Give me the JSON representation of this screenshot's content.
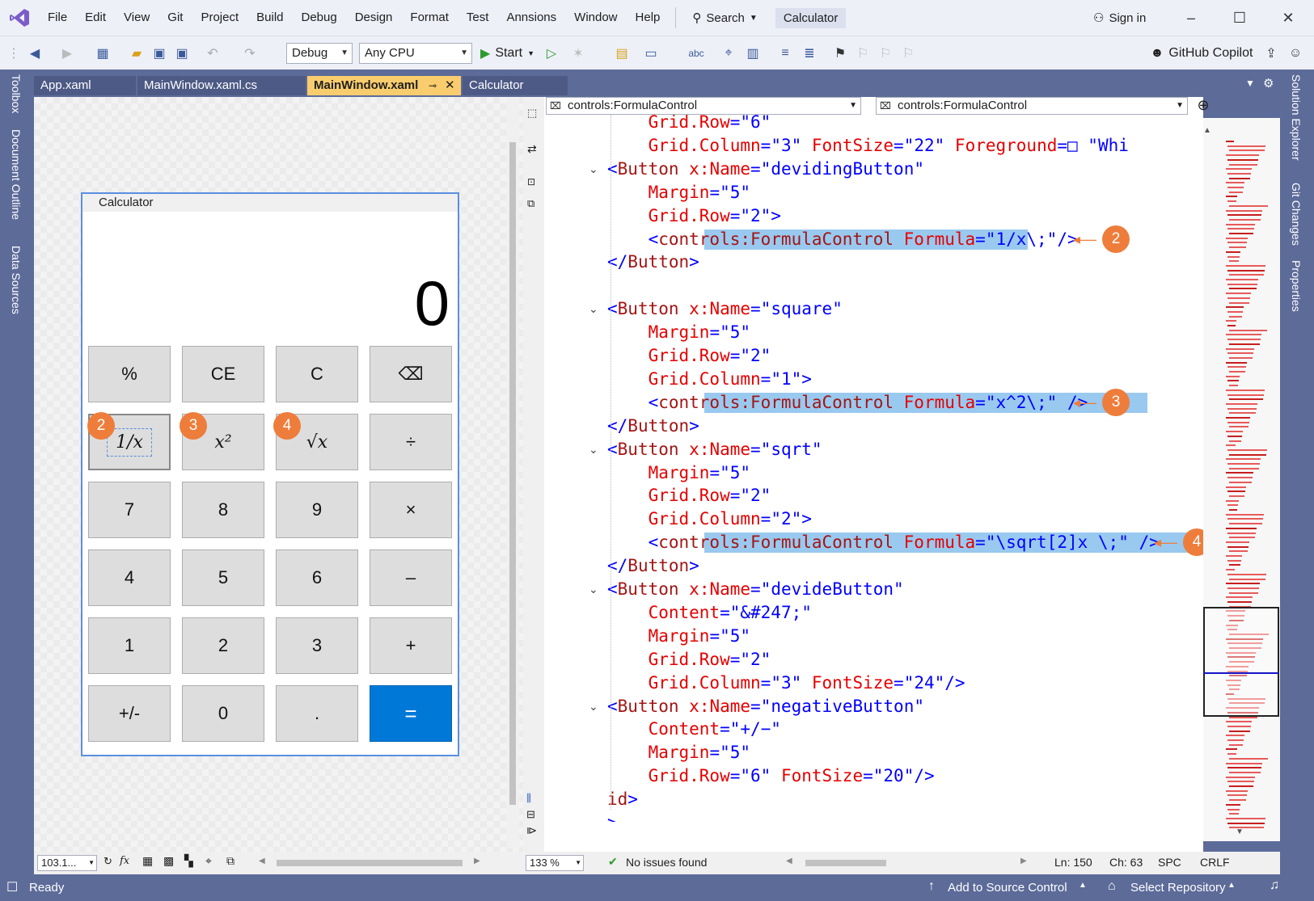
{
  "menu": {
    "items": [
      "File",
      "Edit",
      "View",
      "Git",
      "Project",
      "Build",
      "Debug",
      "Design",
      "Format",
      "Test",
      "Annsions",
      "Window",
      "Help"
    ],
    "search_label": "Search",
    "title_badge": "Calculator",
    "sign_in": "Sign in"
  },
  "toolbar": {
    "config": "Debug",
    "platform": "Any CPU",
    "start": "Start",
    "copilot": "GitHub Copilot"
  },
  "left_tools": [
    "Toolbox",
    "Document Outline",
    "Data Sources"
  ],
  "right_tools": [
    "Solution Explorer",
    "Git Changes",
    "Properties"
  ],
  "tabs": [
    {
      "label": "App.xaml"
    },
    {
      "label": "MainWindow.xaml.cs"
    },
    {
      "label": "MainWindow.xaml"
    },
    {
      "label": "Calculator"
    }
  ],
  "nav": {
    "left": "controls:FormulaControl",
    "right": "controls:FormulaControl"
  },
  "calculator": {
    "title": "Calculator",
    "display": "0",
    "buttons": [
      "%",
      "CE",
      "C",
      "⌫",
      "1/x",
      "x²",
      "√x",
      "÷",
      "7",
      "8",
      "9",
      "×",
      "4",
      "5",
      "6",
      "–",
      "1",
      "2",
      "3",
      "+",
      "+/-",
      "0",
      ".",
      "="
    ]
  },
  "callouts": [
    "2",
    "3",
    "4"
  ],
  "code": [
    {
      "t": [
        [
          "at",
          "    Grid.Row"
        ],
        [
          "pu",
          "="
        ],
        [
          "va",
          "\"6\""
        ]
      ]
    },
    {
      "t": [
        [
          "at",
          "    Grid.Column"
        ],
        [
          "pu",
          "="
        ],
        [
          "va",
          "\"3\" "
        ],
        [
          "at",
          "FontSize"
        ],
        [
          "pu",
          "="
        ],
        [
          "va",
          "\"22\" "
        ],
        [
          "at",
          "Foreground"
        ],
        [
          "pu",
          "="
        ],
        [
          "va",
          "□ \"Whi"
        ]
      ]
    },
    {
      "t": [
        [
          "pu",
          "<"
        ],
        [
          "el",
          "Button "
        ],
        [
          "at",
          "x:Name"
        ],
        [
          "pu",
          "="
        ],
        [
          "va",
          "\"devidingButton\""
        ]
      ]
    },
    {
      "t": [
        [
          "at",
          "    Margin"
        ],
        [
          "pu",
          "="
        ],
        [
          "va",
          "\"5\""
        ]
      ]
    },
    {
      "t": [
        [
          "at",
          "    Grid.Row"
        ],
        [
          "pu",
          "="
        ],
        [
          "va",
          "\"2\">"
        ]
      ]
    },
    {
      "t": [
        [
          "pu",
          "    <"
        ],
        [
          "el",
          "controls:FormulaControl "
        ],
        [
          "at",
          "Formula"
        ],
        [
          "pu",
          "="
        ],
        [
          "va",
          "\"1/x\\;\"/>"
        ]
      ]
    },
    {
      "t": [
        [
          "pu",
          "</"
        ],
        [
          "el",
          "Button"
        ],
        [
          "pu",
          ">"
        ]
      ]
    },
    {
      "t": []
    },
    {
      "t": [
        [
          "pu",
          "<"
        ],
        [
          "el",
          "Button "
        ],
        [
          "at",
          "x:Name"
        ],
        [
          "pu",
          "="
        ],
        [
          "va",
          "\"square\""
        ]
      ]
    },
    {
      "t": [
        [
          "at",
          "    Margin"
        ],
        [
          "pu",
          "="
        ],
        [
          "va",
          "\"5\""
        ]
      ]
    },
    {
      "t": [
        [
          "at",
          "    Grid.Row"
        ],
        [
          "pu",
          "="
        ],
        [
          "va",
          "\"2\""
        ]
      ]
    },
    {
      "t": [
        [
          "at",
          "    Grid.Column"
        ],
        [
          "pu",
          "="
        ],
        [
          "va",
          "\"1\">"
        ]
      ]
    },
    {
      "t": [
        [
          "pu",
          "    <"
        ],
        [
          "el",
          "controls:FormulaControl "
        ],
        [
          "at",
          "Formula"
        ],
        [
          "pu",
          "="
        ],
        [
          "va",
          "\"x^2\\;\" />"
        ]
      ]
    },
    {
      "t": [
        [
          "pu",
          "</"
        ],
        [
          "el",
          "Button"
        ],
        [
          "pu",
          ">"
        ]
      ]
    },
    {
      "t": [
        [
          "pu",
          "<"
        ],
        [
          "el",
          "Button "
        ],
        [
          "at",
          "x:Name"
        ],
        [
          "pu",
          "="
        ],
        [
          "va",
          "\"sqrt\""
        ]
      ]
    },
    {
      "t": [
        [
          "at",
          "    Margin"
        ],
        [
          "pu",
          "="
        ],
        [
          "va",
          "\"5\""
        ]
      ]
    },
    {
      "t": [
        [
          "at",
          "    Grid.Row"
        ],
        [
          "pu",
          "="
        ],
        [
          "va",
          "\"2\""
        ]
      ]
    },
    {
      "t": [
        [
          "at",
          "    Grid.Column"
        ],
        [
          "pu",
          "="
        ],
        [
          "va",
          "\"2\">"
        ]
      ]
    },
    {
      "t": [
        [
          "pu",
          "    <"
        ],
        [
          "el",
          "controls:FormulaControl "
        ],
        [
          "at",
          "Formula"
        ],
        [
          "pu",
          "="
        ],
        [
          "va",
          "\"\\sqrt[2]x \\;\" />"
        ]
      ]
    },
    {
      "t": [
        [
          "pu",
          "</"
        ],
        [
          "el",
          "Button"
        ],
        [
          "pu",
          ">"
        ]
      ]
    },
    {
      "t": [
        [
          "pu",
          "<"
        ],
        [
          "el",
          "Button "
        ],
        [
          "at",
          "x:Name"
        ],
        [
          "pu",
          "="
        ],
        [
          "va",
          "\"devideButton\""
        ]
      ]
    },
    {
      "t": [
        [
          "at",
          "    Content"
        ],
        [
          "pu",
          "="
        ],
        [
          "va",
          "\"&#247;\""
        ]
      ]
    },
    {
      "t": [
        [
          "at",
          "    Margin"
        ],
        [
          "pu",
          "="
        ],
        [
          "va",
          "\"5\""
        ]
      ]
    },
    {
      "t": [
        [
          "at",
          "    Grid.Row"
        ],
        [
          "pu",
          "="
        ],
        [
          "va",
          "\"2\""
        ]
      ]
    },
    {
      "t": [
        [
          "at",
          "    Grid.Column"
        ],
        [
          "pu",
          "="
        ],
        [
          "va",
          "\"3\" "
        ],
        [
          "at",
          "FontSize"
        ],
        [
          "pu",
          "="
        ],
        [
          "va",
          "\"24\"/>"
        ]
      ]
    },
    {
      "t": [
        [
          "pu",
          "<"
        ],
        [
          "el",
          "Button "
        ],
        [
          "at",
          "x:Name"
        ],
        [
          "pu",
          "="
        ],
        [
          "va",
          "\"negativeButton\""
        ]
      ]
    },
    {
      "t": [
        [
          "at",
          "    Content"
        ],
        [
          "pu",
          "="
        ],
        [
          "va",
          "\"+/−\""
        ]
      ]
    },
    {
      "t": [
        [
          "at",
          "    Margin"
        ],
        [
          "pu",
          "="
        ],
        [
          "va",
          "\"5\""
        ]
      ]
    },
    {
      "t": [
        [
          "at",
          "    Grid.Row"
        ],
        [
          "pu",
          "="
        ],
        [
          "va",
          "\"6\" "
        ],
        [
          "at",
          "FontSize"
        ],
        [
          "pu",
          "="
        ],
        [
          "va",
          "\"20\"/>"
        ]
      ]
    },
    {
      "t": [
        [
          "el",
          "id"
        ],
        [
          "pu",
          ">"
        ]
      ]
    },
    {
      "t": [
        [
          "pu",
          ">"
        ]
      ]
    }
  ],
  "editor_status": {
    "zoom": "133 %",
    "issues": "No issues found",
    "ln": "Ln: 150",
    "ch": "Ch: 63",
    "spc": "SPC",
    "crlf": "CRLF"
  },
  "designer_zoom": "103.1...",
  "status": {
    "ready": "Ready",
    "add_source": "Add to Source Control",
    "select_repo": "Select Repository"
  }
}
